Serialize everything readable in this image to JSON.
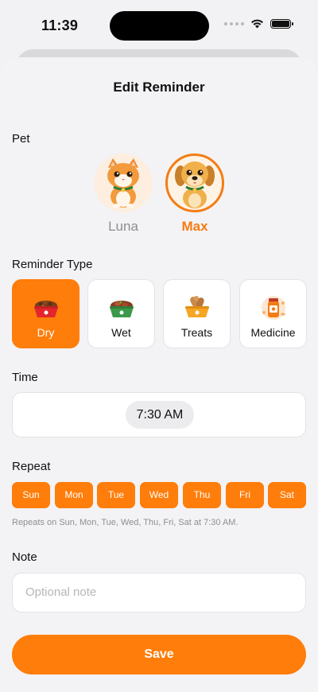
{
  "status_bar": {
    "time": "11:39"
  },
  "header": {
    "title": "Edit Reminder"
  },
  "pet_section": {
    "label": "Pet",
    "pets": [
      {
        "name": "Luna",
        "icon": "cat-avatar-icon",
        "selected": false
      },
      {
        "name": "Max",
        "icon": "dog-avatar-icon",
        "selected": true
      }
    ]
  },
  "reminder_type": {
    "label": "Reminder Type",
    "options": [
      {
        "label": "Dry",
        "icon": "dry-food-bowl-icon",
        "selected": true
      },
      {
        "label": "Wet",
        "icon": "wet-food-bowl-icon",
        "selected": false
      },
      {
        "label": "Treats",
        "icon": "treats-bowl-icon",
        "selected": false
      },
      {
        "label": "Medicine",
        "icon": "medicine-bottle-icon",
        "selected": false
      }
    ]
  },
  "time_section": {
    "label": "Time",
    "value": "7:30 AM"
  },
  "repeat": {
    "label": "Repeat",
    "days": [
      "Sun",
      "Mon",
      "Tue",
      "Wed",
      "Thu",
      "Fri",
      "Sat"
    ],
    "summary": "Repeats on Sun, Mon, Tue, Wed, Thu, Fri, Sat at 7:30 AM."
  },
  "note": {
    "label": "Note",
    "placeholder": "Optional note"
  },
  "save": {
    "label": "Save"
  },
  "colors": {
    "accent": "#ff7d0a",
    "background": "#f3f3f5"
  }
}
